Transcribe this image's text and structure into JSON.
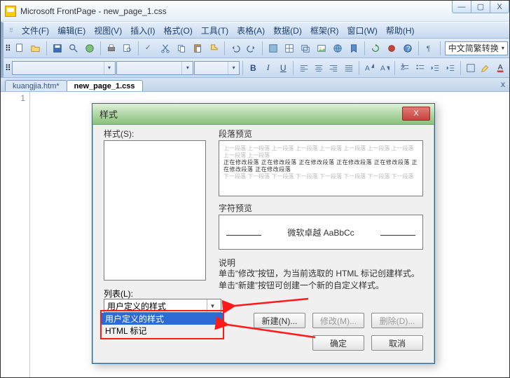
{
  "window": {
    "title": "Microsoft FrontPage - new_page_1.css",
    "min": "—",
    "max": "▢",
    "close": "X"
  },
  "menu": {
    "items": [
      "文件(F)",
      "编辑(E)",
      "视图(V)",
      "插入(I)",
      "格式(O)",
      "工具(T)",
      "表格(A)",
      "数据(D)",
      "框架(R)",
      "窗口(W)",
      "帮助(H)"
    ]
  },
  "toolbar": {
    "combo_label": "中文简繁转换",
    "font_b": "B",
    "font_i": "I",
    "font_u": "U"
  },
  "tabs": {
    "items": [
      {
        "label": "kuangjia.htm*",
        "active": false
      },
      {
        "label": "new_page_1.css",
        "active": true
      }
    ],
    "close": "x"
  },
  "gutter": {
    "line1": "1"
  },
  "dialog": {
    "title": "样式",
    "close": "X",
    "styles_label": "样式(S):",
    "list_label": "列表(L):",
    "list_value": "用户定义的样式",
    "options": [
      "用户定义的样式",
      "HTML 标记"
    ],
    "para_label": "段落预览",
    "para_grey": "上一段落 上一段落 上一段落 上一段落 上一段落 上一段落 上一段落 上一段落 上一段落 上一段落",
    "para_blk": "正在修改段落 正在修改段落 正在修改段落 正在修改段落 正在修改段落 正在修改段落 正在修改段落",
    "para_grey2": "下一段落 下一段落 下一段落 下一段落 下一段落 下一段落 下一段落 下一段落",
    "char_label": "字符预览",
    "char_text": "微软卓越 AaBbCc",
    "desc_label": "说明",
    "desc_text": "单击“修改”按钮，为当前选取的 HTML 标记创建样式。\n单击“新建”按钮可创建一个新的自定义样式。",
    "btn_new": "新建(N)...",
    "btn_mod": "修改(M)...",
    "btn_del": "删除(D)...",
    "btn_ok": "确定",
    "btn_cancel": "取消"
  }
}
